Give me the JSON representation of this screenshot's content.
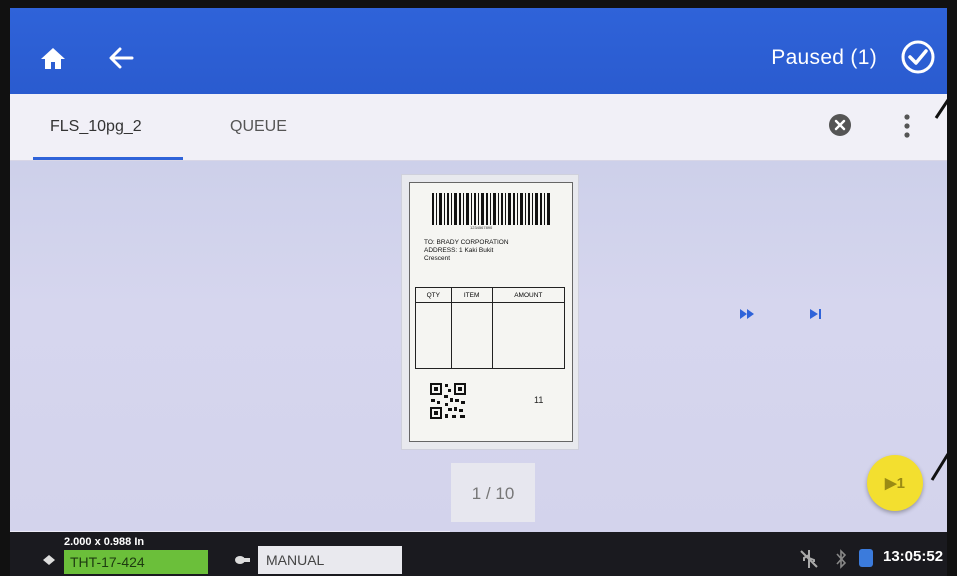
{
  "header": {
    "status_text": "Paused (1)"
  },
  "tabs": [
    {
      "label": "FLS_10pg_2",
      "active": true
    },
    {
      "label": "QUEUE",
      "active": false
    }
  ],
  "preview": {
    "barcode_number": "1234567890",
    "address_lines": [
      "TO: BRADY CORPORATION",
      "ADDRESS: 1 Kaki Bukit",
      "Crescent"
    ],
    "table_headers": [
      "QTY",
      "ITEM",
      "AMOUNT"
    ],
    "qty_value": "11"
  },
  "pager": {
    "current": "1",
    "total": "/ 10"
  },
  "print_button": {
    "label": "▶1"
  },
  "status_bar": {
    "media_dims": "2.000 x 0.988 In",
    "media_part": "THT-17-424",
    "ribbon_mode": "MANUAL",
    "time": "13:05:52"
  },
  "colors": {
    "header_blue": "#2f63d9",
    "media_green": "#6bbf3a",
    "fab_yellow": "#f3df2f"
  }
}
